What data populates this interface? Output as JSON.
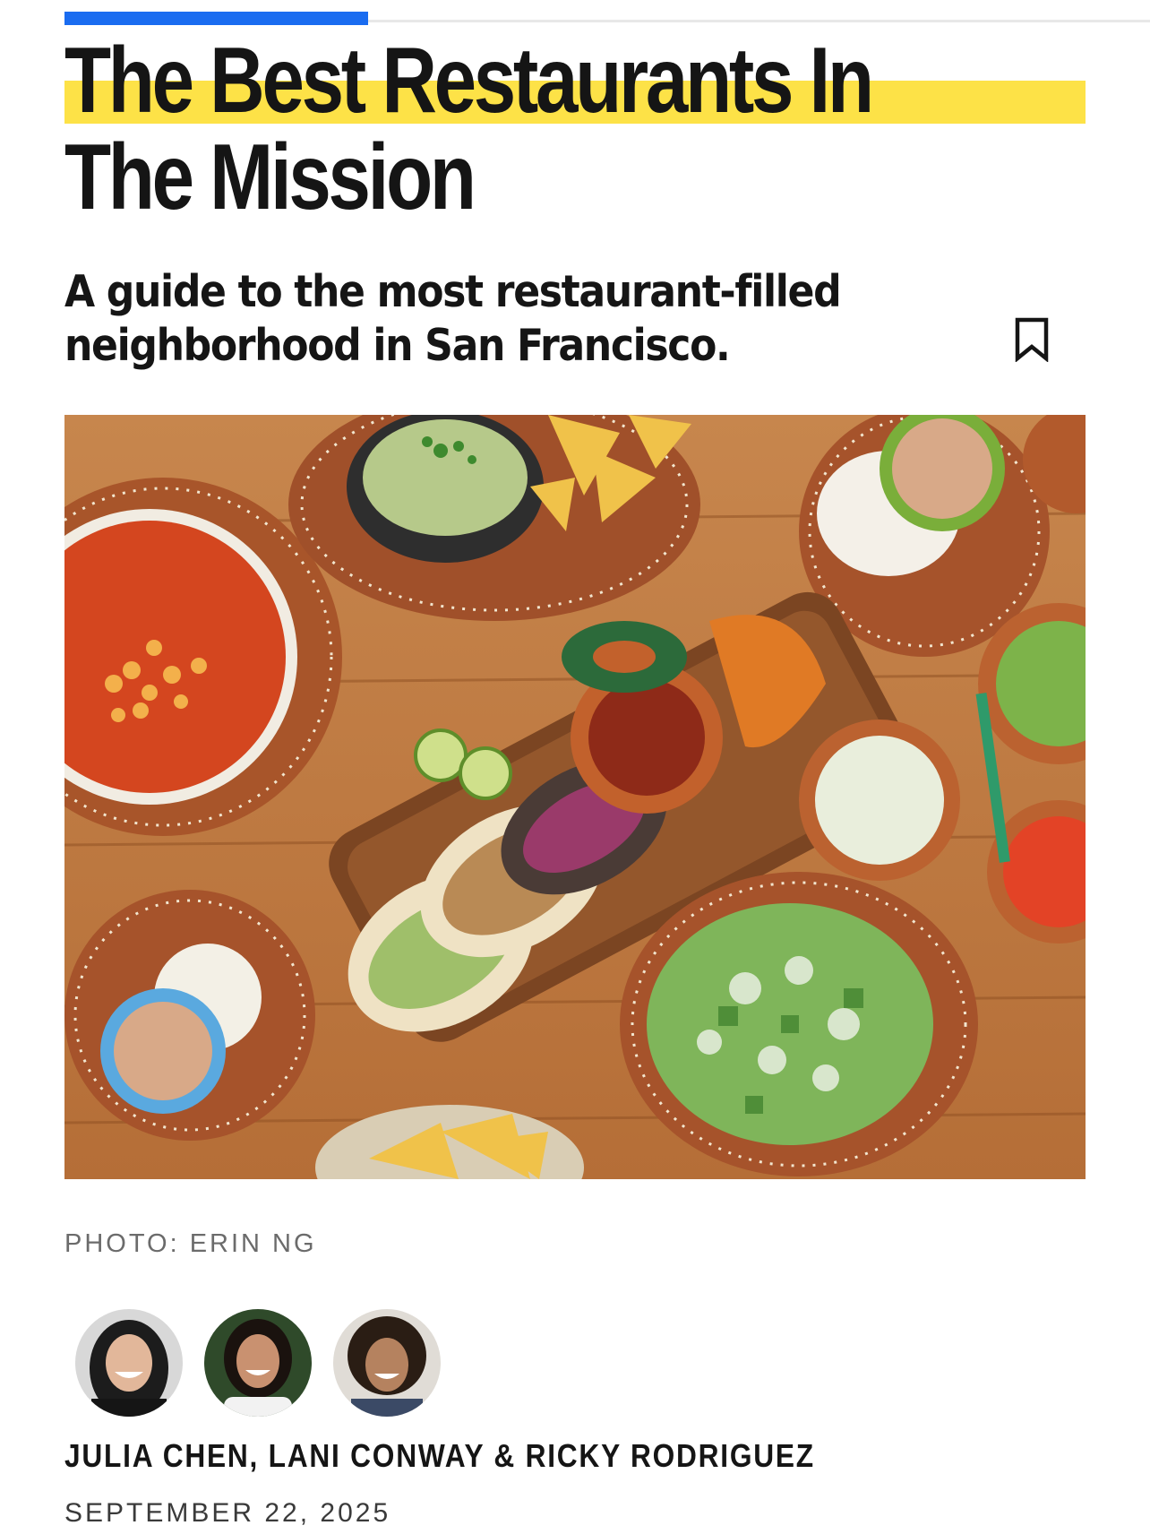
{
  "reading_progress": 0.28,
  "colors": {
    "progress": "#1a6cf0",
    "highlight": "#fde247",
    "text": "#151515",
    "caption": "#6b6b6b"
  },
  "article": {
    "headline_line1": "The Best Restaurants In",
    "headline_line2": "The Mission",
    "subhead_line1": "A guide to the most restaurant-filled",
    "subhead_line2": "neighborhood in San Francisco.",
    "bookmark_icon": "bookmark-icon",
    "photo_credit": "PHOTO: ERIN NG",
    "authors": [
      {
        "name": "JULIA CHEN"
      },
      {
        "name": "LANI CONWAY"
      },
      {
        "name": "RICKY RODRIGUEZ"
      }
    ],
    "byline_sep1": ", ",
    "byline_sep2": " & ",
    "date": "SEPTEMBER 22, 2025"
  }
}
